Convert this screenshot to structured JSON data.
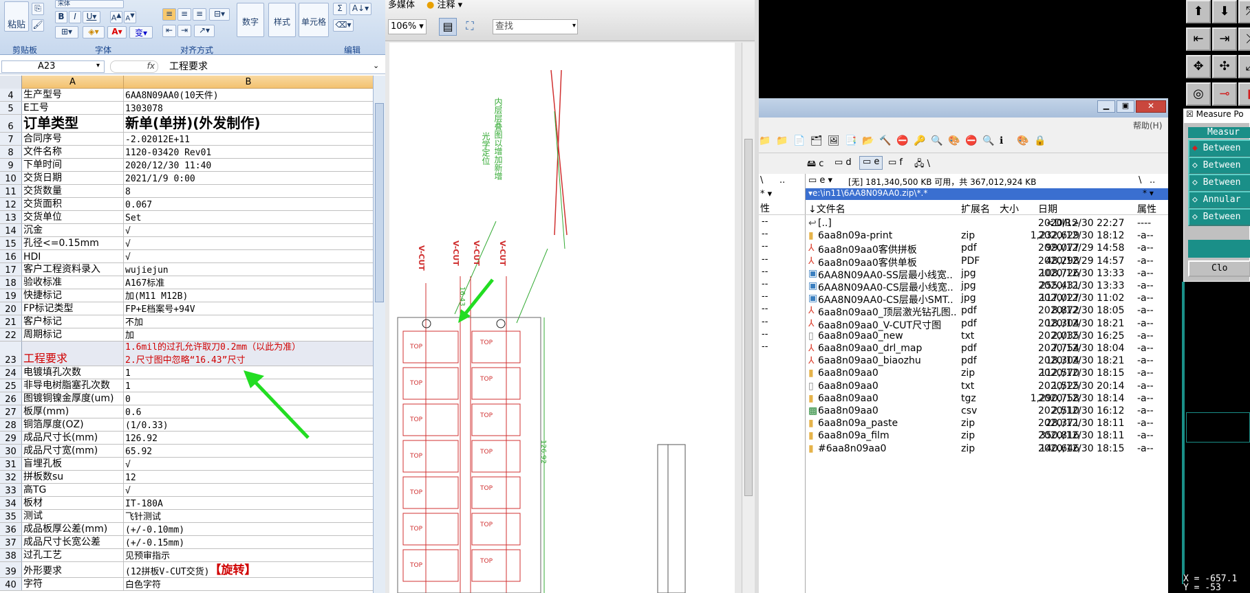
{
  "excel": {
    "ribbon": {
      "paste_label": "粘贴",
      "clipboard_label": "剪贴板",
      "font_group_label": "字体",
      "align_group_label": "对齐方式",
      "number_label": "数字",
      "style_label": "样式",
      "cell_label": "单元格",
      "edit_label": "编辑",
      "font_name": "宋体"
    },
    "name_box": "A23",
    "fx": "fx",
    "formula_value": "工程要求",
    "col_a": "A",
    "col_b": "B",
    "rows": [
      {
        "n": "4",
        "a": "生产型号",
        "b": "6AA8N09AA0(10天件)"
      },
      {
        "n": "5",
        "a": "E工号",
        "b": "1303078"
      },
      {
        "n": "6",
        "a": "订单类型",
        "b": "新单(单拼)(外发制作)",
        "big": true
      },
      {
        "n": "7",
        "a": "合同序号",
        "b": "-2.02012E+11"
      },
      {
        "n": "8",
        "a": "文件名称",
        "b": "1120-03420 Rev01"
      },
      {
        "n": "9",
        "a": "下单时间",
        "b": "2020/12/30 11:40"
      },
      {
        "n": "10",
        "a": "交货日期",
        "b": "2021/1/9 0:00"
      },
      {
        "n": "11",
        "a": "交货数量",
        "b": "8"
      },
      {
        "n": "12",
        "a": "交货面积",
        "b": "0.067"
      },
      {
        "n": "13",
        "a": "交货单位",
        "b": "Set"
      },
      {
        "n": "14",
        "a": "沉金",
        "b": "√"
      },
      {
        "n": "15",
        "a": "孔径<=0.15mm",
        "b": "√"
      },
      {
        "n": "16",
        "a": "HDI",
        "b": "√"
      },
      {
        "n": "17",
        "a": "客户工程资料录入",
        "b": "wujiejun"
      },
      {
        "n": "18",
        "a": "验收标准",
        "b": "A167标准"
      },
      {
        "n": "19",
        "a": "快捷标记",
        "b": "加(M11 M12B)"
      },
      {
        "n": "20",
        "a": "FP标记类型",
        "b": "FP+E档案号+94V"
      },
      {
        "n": "21",
        "a": "客户标记",
        "b": "不加"
      },
      {
        "n": "22",
        "a": "周期标记",
        "b": "加"
      },
      {
        "n": "23",
        "a": "工程要求",
        "b": "1.6mil的过孔允许取刀0.2mm（以此为准）",
        "b2": "2.尺寸图中忽略“16.43”尺寸",
        "red": true
      },
      {
        "n": "24",
        "a": "电镀填孔次数",
        "b": "1"
      },
      {
        "n": "25",
        "a": "非导电树脂塞孔次数",
        "b": "1"
      },
      {
        "n": "26",
        "a": "图镀铜镍金厚度(um)",
        "b": "0"
      },
      {
        "n": "27",
        "a": "板厚(mm)",
        "b": "0.6"
      },
      {
        "n": "28",
        "a": "铜箔厚度(OZ)",
        "b": " (1/0.33)"
      },
      {
        "n": "29",
        "a": "成品尺寸长(mm)",
        "b": "126.92"
      },
      {
        "n": "30",
        "a": "成品尺寸宽(mm)",
        "b": "65.92"
      },
      {
        "n": "31",
        "a": "盲埋孔板",
        "b": "√"
      },
      {
        "n": "32",
        "a": "拼板数su",
        "b": "12"
      },
      {
        "n": "33",
        "a": "高TG",
        "b": "√"
      },
      {
        "n": "34",
        "a": "板材",
        "b": "IT-180A"
      },
      {
        "n": "35",
        "a": "测试",
        "b": "飞针测试"
      },
      {
        "n": "36",
        "a": "成品板厚公差(mm)",
        "b": "(+/-0.10mm)"
      },
      {
        "n": "37",
        "a": "成品尺寸长宽公差",
        "b": "(+/-0.15mm)"
      },
      {
        "n": "38",
        "a": "过孔工艺",
        "b": "见预审指示"
      },
      {
        "n": "39",
        "a": "外形要求",
        "b": "(12拼板V-CUT交货)",
        "b_red": "【旋转】"
      },
      {
        "n": "40",
        "a": "字符",
        "b": "白色字符"
      }
    ]
  },
  "pdf": {
    "menu_media": "多媒体",
    "menu_annotate": "注释",
    "zoom": "106%",
    "search_placeholder": "查找",
    "vcut_label": "V-CUT",
    "top_label": "TOP",
    "dim_label": "126.92",
    "note1": "内层层叠图以增加新增",
    "note2": "光学定位",
    "note3": "16.43"
  },
  "fm": {
    "help_menu": "帮助(H)",
    "drives": [
      "c",
      "d",
      "e",
      "f",
      "\\"
    ],
    "free_space": "[无] 181,340,500 KB 可用，共 367,012,924 KB",
    "drive_sel": "e",
    "path": "e:\\in11\\6AA8N09AA0.zip\\*.*",
    "left_path": "\\",
    "left_dots": "..",
    "col_name": "↓文件名",
    "col_ext": "扩展名",
    "col_size": "大小",
    "col_date": "日期",
    "col_attr": "属性",
    "left_col_attr": "性",
    "files": [
      {
        "name": "[..]",
        "ext": "",
        "size": "<DIR>",
        "date": "2020/12/30 22:27",
        "attr": "----",
        "icon": "up"
      },
      {
        "name": "6aa8n09a-print",
        "ext": "zip",
        "size": "1,232,629",
        "date": "2020/12/30 18:12",
        "attr": "-a--",
        "icon": "zip"
      },
      {
        "name": "6aa8n09aa0客供拼板",
        "ext": "pdf",
        "size": "99,077",
        "date": "2020/12/29 14:58",
        "attr": "-a--",
        "icon": "pdf"
      },
      {
        "name": "6aa8n09aa0客供单板",
        "ext": "PDF",
        "size": "48,298",
        "date": "2020/12/29 14:57",
        "attr": "-a--",
        "icon": "pdf"
      },
      {
        "name": "6AA8N09AA0-SS层最小线宽..",
        "ext": "jpg",
        "size": "108,726",
        "date": "2020/12/30 13:33",
        "attr": "-a--",
        "icon": "img"
      },
      {
        "name": "6AA8N09AA0-CS层最小线宽..",
        "ext": "jpg",
        "size": "255,431",
        "date": "2020/12/30 13:33",
        "attr": "-a--",
        "icon": "img"
      },
      {
        "name": "6AA8N09AA0-CS层最小SMT..",
        "ext": "jpg",
        "size": "117,027",
        "date": "2020/12/30 11:02",
        "attr": "-a--",
        "icon": "img"
      },
      {
        "name": "6aa8n09aa0_顶层激光钻孔图..",
        "ext": "pdf",
        "size": "8,872",
        "date": "2020/12/30 18:05",
        "attr": "-a--",
        "icon": "pdf"
      },
      {
        "name": "6aa8n09aa0_V-CUT尺寸图",
        "ext": "pdf",
        "size": "18,304",
        "date": "2020/12/30 18:21",
        "attr": "-a--",
        "icon": "pdf"
      },
      {
        "name": "6aa8n09aa0_new",
        "ext": "txt",
        "size": "2,035",
        "date": "2020/12/30 16:25",
        "attr": "-a--",
        "icon": "txt"
      },
      {
        "name": "6aa8n09aa0_drl_map",
        "ext": "pdf",
        "size": "7,754",
        "date": "2020/12/30 18:04",
        "attr": "-a--",
        "icon": "pdf"
      },
      {
        "name": "6aa8n09aa0_biaozhu",
        "ext": "pdf",
        "size": "18,304",
        "date": "2020/12/30 18:21",
        "attr": "-a--",
        "icon": "pdf"
      },
      {
        "name": "6aa8n09aa0",
        "ext": "zip",
        "size": "112,570",
        "date": "2020/12/30 18:15",
        "attr": "-a--",
        "icon": "zip"
      },
      {
        "name": "6aa8n09aa0",
        "ext": "txt",
        "size": "1,525",
        "date": "2020/12/30 20:14",
        "attr": "-a--",
        "icon": "txt"
      },
      {
        "name": "6aa8n09aa0",
        "ext": "tgz",
        "size": "1,290,758",
        "date": "2020/12/30 18:14",
        "attr": "-a--",
        "icon": "zip"
      },
      {
        "name": "6aa8n09aa0",
        "ext": "csv",
        "size": "2,510",
        "date": "2020/12/30 16:12",
        "attr": "-a--",
        "icon": "csv"
      },
      {
        "name": "6aa8n09a_paste",
        "ext": "zip",
        "size": "28,371",
        "date": "2020/12/30 18:11",
        "attr": "-a--",
        "icon": "zip"
      },
      {
        "name": "6aa8n09a_film",
        "ext": "zip",
        "size": "350,816",
        "date": "2020/12/30 18:11",
        "attr": "-a--",
        "icon": "zip"
      },
      {
        "name": "#6aa8n09aa0",
        "ext": "zip",
        "size": "140,646",
        "date": "2020/12/30 18:15",
        "attr": "-a--",
        "icon": "zip"
      }
    ]
  },
  "cad": {
    "measure_title": "Measure Po",
    "measure_header": "Measur",
    "items": [
      "Between",
      "Between",
      "Between",
      "Annular",
      "Between"
    ],
    "close": "Clo",
    "coord_x": "X = -657.1",
    "coord_y": "Y = -53"
  },
  "colors": {
    "accent": "#15428b",
    "red": "#d00000",
    "teal": "#1a8f88",
    "cadred": "#d02020",
    "green": "#22dd22"
  }
}
